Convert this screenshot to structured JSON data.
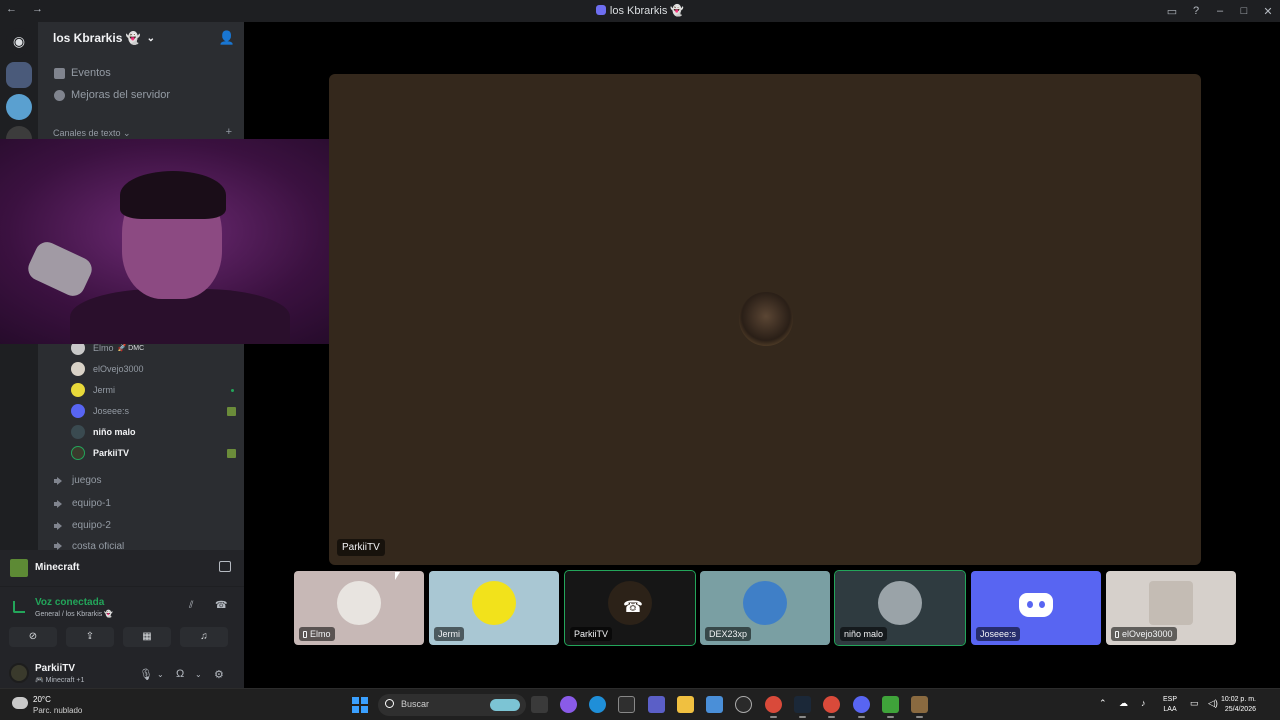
{
  "window": {
    "title": "los Kbrarkis 👻",
    "nav": "← →"
  },
  "server": {
    "name": "los Kbrarkis 👻",
    "links": [
      {
        "label": "Eventos"
      },
      {
        "label": "Mejoras del servidor"
      }
    ],
    "category": "Canales de texto"
  },
  "voice_members": [
    {
      "name": "Elmo",
      "tag": "🚀 DMC",
      "bold": false,
      "color": "#c8c8c8"
    },
    {
      "name": "elOvejo3000",
      "tag": "",
      "bold": false,
      "color": "#d9d2c7"
    },
    {
      "name": "Jermi",
      "tag": "",
      "bold": false,
      "color": "#e8d93a"
    },
    {
      "name": "Joseee:s",
      "tag": "",
      "bold": false,
      "color": "#5865f2"
    },
    {
      "name": "niño malo",
      "tag": "",
      "bold": true,
      "color": "#3a4a50"
    },
    {
      "name": "ParkiiTV",
      "tag": "",
      "bold": true,
      "color": "#3a3a2c"
    }
  ],
  "voice_channels": [
    {
      "label": "juegos"
    },
    {
      "label": "equipo-1"
    },
    {
      "label": "equipo-2"
    },
    {
      "label": "costa oficial"
    }
  ],
  "activity": {
    "game": "Minecraft"
  },
  "voice_panel": {
    "status": "Voz conectada",
    "location": "General / los Kbrarkis 👻"
  },
  "user": {
    "name": "ParkiiTV",
    "activity": "🎮 Minecraft +1"
  },
  "stage": {
    "label": "ParkiiTV"
  },
  "tiles": [
    {
      "name": "Elmo",
      "mobile": true,
      "bg": "#c7b8b6",
      "avatar": "#e8e4e0"
    },
    {
      "name": "Jermi",
      "mobile": false,
      "bg": "#a9c7d3",
      "avatar": "#f2e21b"
    },
    {
      "name": "ParkiiTV",
      "mobile": false,
      "bg": "#161616",
      "avatar": "#2c2218"
    },
    {
      "name": "DEX23xp",
      "mobile": false,
      "bg": "#7a9fa3",
      "avatar": "#3f7fc7"
    },
    {
      "name": "niño malo",
      "mobile": false,
      "bg": "#2f3b40",
      "avatar": "#9aa3a8"
    },
    {
      "name": "Joseee:s",
      "mobile": false,
      "bg": "#5865f2",
      "avatar": ""
    },
    {
      "name": "elOvejo3000",
      "mobile": true,
      "bg": "#d6d0cb",
      "avatar": "#c4bcb4"
    }
  ],
  "taskbar": {
    "temp": "20°C",
    "weather": "Parc. nublado",
    "search_placeholder": "Buscar",
    "lang_1": "ESP",
    "lang_2": "LAA",
    "time": "10:02 p. m.",
    "date": "25/4/2026"
  },
  "colors": {
    "accent": "#5865f2",
    "online": "#23a55a"
  }
}
